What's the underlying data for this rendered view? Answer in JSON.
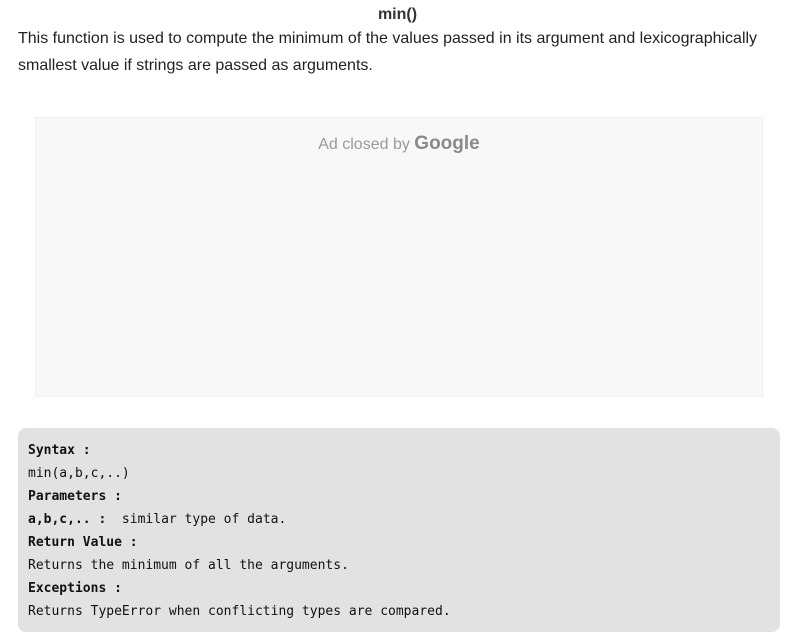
{
  "heading": "min()",
  "description": "This function is used to compute the minimum of the values passed in its argument and lexicographically smallest value if strings are passed as arguments.",
  "ad": {
    "text": "Ad closed by",
    "brand": "Google"
  },
  "code": {
    "syntax_label": "Syntax :",
    "syntax_value": "min(a,b,c,..)",
    "parameters_label": "Parameters :",
    "param_name": "a,b,c,.. :",
    "param_desc": "  similar type of data.",
    "return_label": "Return Value :",
    "return_value": "Returns the minimum of all the arguments.",
    "exceptions_label": "Exceptions :",
    "exceptions_value": "Returns TypeError when conflicting types are compared."
  }
}
